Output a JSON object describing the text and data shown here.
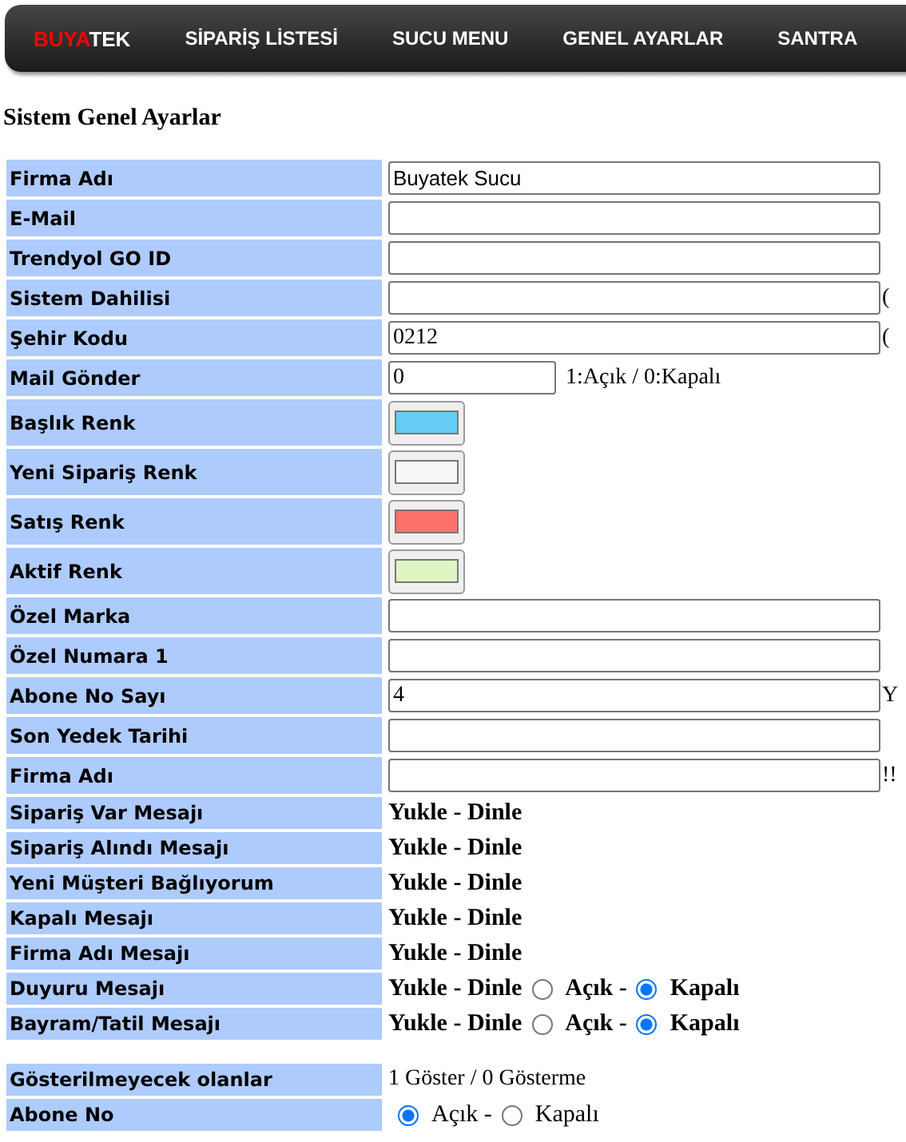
{
  "nav": {
    "logo": [
      "BUYA",
      "TEK"
    ],
    "items": [
      {
        "label": "SİPARİŞ LİSTESİ"
      },
      {
        "label": "SUCU MENU"
      },
      {
        "label": "GENEL AYARLAR"
      },
      {
        "label": "SANTRA"
      }
    ]
  },
  "title": "Sistem Genel Ayarlar",
  "sections": [
    {
      "rows": [
        {
          "kind": "text",
          "label": "Firma Adı",
          "value": "Buyatek Sucu"
        },
        {
          "kind": "text",
          "label": "E-Mail"
        },
        {
          "kind": "text",
          "label": "Trendyol GO ID"
        },
        {
          "kind": "text",
          "label": "Sistem Dahilisi",
          "suffix": "("
        },
        {
          "kind": "text",
          "label": "Şehir Kodu",
          "value": "0212",
          "suffix": "("
        },
        {
          "kind": "short",
          "label": "Mail Gönder",
          "value": "0",
          "note": "1:Açık / 0:Kapalı"
        },
        {
          "kind": "color",
          "label": "Başlık Renk",
          "color": "#66ccf5"
        },
        {
          "kind": "color",
          "label": "Yeni Sipariş Renk",
          "color": "#f8f8f8"
        },
        {
          "kind": "color",
          "label": "Satış Renk",
          "color": "#fc726a"
        },
        {
          "kind": "color",
          "label": "Aktif Renk",
          "color": "#e0f5c2"
        },
        {
          "kind": "text",
          "label": "Özel Marka"
        },
        {
          "kind": "text",
          "label": "Özel Numara 1"
        },
        {
          "kind": "text",
          "label": "Abone No Sayı",
          "value": "4",
          "suffix": "Y"
        },
        {
          "kind": "text",
          "label": "Son Yedek Tarihi"
        },
        {
          "kind": "text",
          "label": "Firma Adı",
          "suffix": "!!"
        },
        {
          "kind": "message",
          "label": "Sipariş Var Mesajı",
          "action": "Yukle - Dinle"
        },
        {
          "kind": "message",
          "label": "Sipariş Alındı Mesajı",
          "action": "Yukle - Dinle"
        },
        {
          "kind": "message",
          "label": "Yeni Müşteri Bağlıyorum",
          "action": "Yukle - Dinle"
        },
        {
          "kind": "message",
          "label": "Kapalı Mesajı",
          "action": "Yukle - Dinle"
        },
        {
          "kind": "message",
          "label": "Firma Adı Mesajı",
          "action": "Yukle - Dinle"
        },
        {
          "kind": "message",
          "label": "Duyuru Mesajı",
          "action": "Yukle - Dinle",
          "options": [
            {
              "label": "Açık -",
              "selected": false
            },
            {
              "label": "Kapalı",
              "selected": true
            }
          ]
        },
        {
          "kind": "message",
          "label": "Bayram/Tatil Mesajı",
          "action": "Yukle - Dinle",
          "options": [
            {
              "label": "Açık -",
              "selected": false
            },
            {
              "label": "Kapalı",
              "selected": true
            }
          ]
        }
      ]
    },
    {
      "rows": [
        {
          "kind": "note",
          "label": "Gösterilmeyecek olanlar",
          "note": "1 Göster / 0 Gösterme"
        },
        {
          "kind": "radio",
          "label": "Abone No",
          "options": [
            {
              "label": "Açık -",
              "selected": true
            },
            {
              "label": "Kapalı",
              "selected": false
            }
          ]
        }
      ]
    }
  ]
}
